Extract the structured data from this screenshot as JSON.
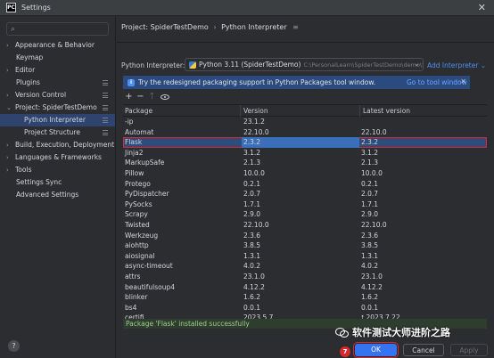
{
  "window": {
    "title": "Settings",
    "app_logo_text": "PC"
  },
  "sidebar": {
    "search_icon": "search-icon",
    "items": [
      {
        "label": "Appearance & Behavior",
        "chevron": "›",
        "type": "group",
        "has_settings_icon": false
      },
      {
        "label": "Keymap",
        "chevron": "",
        "type": "plain",
        "has_settings_icon": false
      },
      {
        "label": "Editor",
        "chevron": "›",
        "type": "group",
        "has_settings_icon": false
      },
      {
        "label": "Plugins",
        "chevron": "",
        "type": "plain",
        "has_settings_icon": true
      },
      {
        "label": "Version Control",
        "chevron": "›",
        "type": "group",
        "has_settings_icon": true
      },
      {
        "label": "Project: SpiderTestDemo",
        "chevron": "⌄",
        "type": "group",
        "has_settings_icon": true
      },
      {
        "label": "Python Interpreter",
        "chevron": "",
        "type": "child",
        "has_settings_icon": true,
        "active": true
      },
      {
        "label": "Project Structure",
        "chevron": "",
        "type": "child",
        "has_settings_icon": true
      },
      {
        "label": "Build, Execution, Deployment",
        "chevron": "›",
        "type": "group",
        "has_settings_icon": false
      },
      {
        "label": "Languages & Frameworks",
        "chevron": "›",
        "type": "group",
        "has_settings_icon": false
      },
      {
        "label": "Tools",
        "chevron": "›",
        "type": "group",
        "has_settings_icon": false
      },
      {
        "label": "Settings Sync",
        "chevron": "",
        "type": "plain",
        "has_settings_icon": false
      },
      {
        "label": "Advanced Settings",
        "chevron": "",
        "type": "plain",
        "has_settings_icon": false
      }
    ],
    "help_label": "?"
  },
  "breadcrumb": {
    "project": "Project: SpiderTestDemo",
    "separator": "›",
    "page": "Python Interpreter",
    "menu_icon": "≡"
  },
  "interpreter": {
    "label": "Python Interpreter:",
    "name": "Python 3.11 (SpiderTestDemo)",
    "path": "C:\\PersonalLearn\\SpiderTestDemo\\demo\\Scrip",
    "dropdown_icon": "⌄",
    "add_link": "Add Interpreter ⌄"
  },
  "banner": {
    "icon": "i",
    "text": "Try the redesigned packaging support in Python Packages tool window.",
    "link": "Go to tool window",
    "close": "✕"
  },
  "toolbar": {
    "add": "+",
    "remove": "−",
    "upgrade": "↑",
    "show_early": "eye-icon"
  },
  "table": {
    "columns": [
      "Package",
      "Version",
      "Latest version"
    ],
    "rows": [
      {
        "package": "-ip",
        "version": "23.1.2",
        "latest": ""
      },
      {
        "package": "Automat",
        "version": "22.10.0",
        "latest": "22.10.0"
      },
      {
        "package": "Flask",
        "version": "2.3.2",
        "latest": "2.3.2",
        "selected": true
      },
      {
        "package": "Jinja2",
        "version": "3.1.2",
        "latest": "3.1.2"
      },
      {
        "package": "MarkupSafe",
        "version": "2.1.3",
        "latest": "2.1.3"
      },
      {
        "package": "Pillow",
        "version": "10.0.0",
        "latest": "10.0.0"
      },
      {
        "package": "Protego",
        "version": "0.2.1",
        "latest": "0.2.1"
      },
      {
        "package": "PyDispatcher",
        "version": "2.0.7",
        "latest": "2.0.7"
      },
      {
        "package": "PySocks",
        "version": "1.7.1",
        "latest": "1.7.1"
      },
      {
        "package": "Scrapy",
        "version": "2.9.0",
        "latest": "2.9.0"
      },
      {
        "package": "Twisted",
        "version": "22.10.0",
        "latest": "22.10.0"
      },
      {
        "package": "Werkzeug",
        "version": "2.3.6",
        "latest": "2.3.6"
      },
      {
        "package": "aiohttp",
        "version": "3.8.5",
        "latest": "3.8.5"
      },
      {
        "package": "aiosignal",
        "version": "1.3.1",
        "latest": "1.3.1"
      },
      {
        "package": "async-timeout",
        "version": "4.0.2",
        "latest": "4.0.2"
      },
      {
        "package": "attrs",
        "version": "23.1.0",
        "latest": "23.1.0"
      },
      {
        "package": "beautifulsoup4",
        "version": "4.12.2",
        "latest": "4.12.2"
      },
      {
        "package": "blinker",
        "version": "1.6.2",
        "latest": "1.6.2"
      },
      {
        "package": "bs4",
        "version": "0.0.1",
        "latest": "0.0.1"
      },
      {
        "package": "certifi",
        "version": "2023.5.7",
        "latest": "2023.7.22",
        "upgrade": true
      }
    ]
  },
  "status": {
    "message": "Package 'Flask' installed successfully"
  },
  "footer": {
    "ok": "OK",
    "cancel": "Cancel",
    "apply": "Apply",
    "step_badge": "7"
  },
  "watermark": {
    "text": "软件测试大师进阶之路"
  },
  "colors": {
    "accent": "#3574f0",
    "selection": "#2e4d7c",
    "highlight_box": "#d9272d",
    "banner": "#2b4a7e",
    "success_text": "#9acb8d"
  }
}
